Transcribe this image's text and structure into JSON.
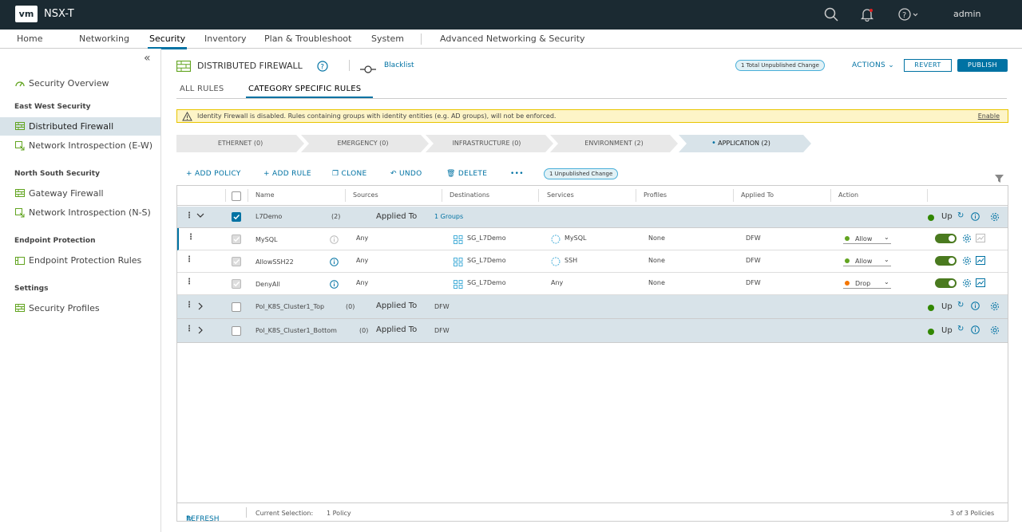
{
  "app": {
    "logo": "vm",
    "title": "NSX-T",
    "user": "admin"
  },
  "nav": [
    "Home",
    "Networking",
    "Security",
    "Inventory",
    "Plan & Troubleshoot",
    "System",
    "Advanced Networking & Security"
  ],
  "sidebar": {
    "overview": "Security Overview",
    "sections": [
      {
        "head": "East West Security",
        "items": [
          "Distributed Firewall",
          "Network Introspection (E-W)"
        ]
      },
      {
        "head": "North South Security",
        "items": [
          "Gateway Firewall",
          "Network Introspection (N-S)"
        ]
      },
      {
        "head": "Endpoint Protection",
        "items": [
          "Endpoint Protection Rules"
        ]
      },
      {
        "head": "Settings",
        "items": [
          "Security Profiles"
        ]
      }
    ]
  },
  "header": {
    "title": "DISTRIBUTED FIREWALL",
    "blacklist": "Blacklist",
    "unpublished_total": "1 Total Unpublished Change",
    "actions": "ACTIONS",
    "revert": "REVERT",
    "publish": "PUBLISH"
  },
  "tabs": [
    "ALL RULES",
    "CATEGORY SPECIFIC RULES"
  ],
  "alert": {
    "message": "Identity Firewall is disabled. Rules containing groups with identity entities (e.g. AD groups), will not be enforced.",
    "link": "Enable"
  },
  "categories": [
    "ETHERNET (0)",
    "EMERGENCY (0)",
    "INFRASTRUCTURE (0)",
    "ENVIRONMENT (2)",
    "APPLICATION (2)"
  ],
  "toolbar": {
    "add_policy": "ADD POLICY",
    "add_rule": "ADD RULE",
    "clone": "CLONE",
    "undo": "UNDO",
    "delete": "DELETE",
    "more": "•••",
    "unpublished": "1 Unpublished Change"
  },
  "columns": [
    "Name",
    "Sources",
    "Destinations",
    "Services",
    "Profiles",
    "Applied To",
    "Action"
  ],
  "policies": [
    {
      "name": "L7Demo",
      "count": "(2)",
      "applied_label": "Applied To",
      "applied": "1 Groups",
      "status": "Up"
    },
    {
      "name": "Pol_K8S_Cluster1_Top",
      "count": "(0)",
      "applied_label": "Applied To",
      "applied": "DFW",
      "status": "Up"
    },
    {
      "name": "Pol_K8S_Cluster1_Bottom",
      "count": "(0)",
      "applied_label": "Applied To",
      "applied": "DFW",
      "status": "Up"
    }
  ],
  "rules": [
    {
      "name": "MySQL",
      "sources": "Any",
      "dest": "SG_L7Demo",
      "service": "MySQL",
      "profile": "None",
      "applied": "DFW",
      "action": "Allow",
      "action_color": "#62a420"
    },
    {
      "name": "AllowSSH22",
      "sources": "Any",
      "dest": "SG_L7Demo",
      "service": "SSH",
      "profile": "None",
      "applied": "DFW",
      "action": "Allow",
      "action_color": "#62a420"
    },
    {
      "name": "DenyAll",
      "sources": "Any",
      "dest": "SG_L7Demo",
      "service": "Any",
      "profile": "None",
      "applied": "DFW",
      "action": "Drop",
      "action_color": "#f57600"
    }
  ],
  "footer": {
    "refresh": "REFRESH",
    "selection": "Current Selection:",
    "selection_value": "1 Policy",
    "count": "3 of 3 Policies"
  },
  "colors": {
    "topbar": "#1b2a32",
    "accent": "#0072a3",
    "policy_row": "#d8e3e9",
    "status_green": "#318700"
  }
}
